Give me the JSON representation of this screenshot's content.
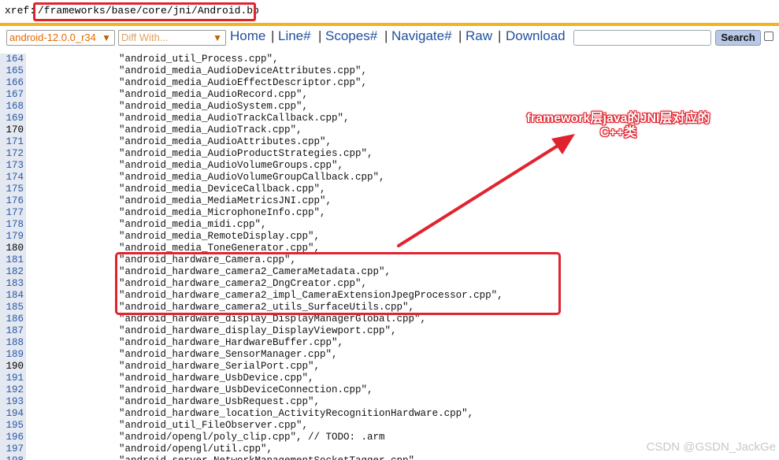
{
  "xref": {
    "label": "xref:",
    "path": "/frameworks/base/core/jni/Android.bp"
  },
  "toolbar": {
    "revision_select": "android-12.0.0_r34",
    "diff_select": "Diff With...",
    "links": [
      "Home",
      "Line#",
      "Scopes#",
      "Navigate#",
      "Raw",
      "Download"
    ],
    "separator": "|",
    "search_value": "",
    "search_button": "Search"
  },
  "code_lines": [
    {
      "n": "164",
      "text": "\"android_util_Process.cpp\","
    },
    {
      "n": "165",
      "text": "\"android_media_AudioDeviceAttributes.cpp\","
    },
    {
      "n": "166",
      "text": "\"android_media_AudioEffectDescriptor.cpp\","
    },
    {
      "n": "167",
      "text": "\"android_media_AudioRecord.cpp\","
    },
    {
      "n": "168",
      "text": "\"android_media_AudioSystem.cpp\","
    },
    {
      "n": "169",
      "text": "\"android_media_AudioTrackCallback.cpp\","
    },
    {
      "n": "170",
      "text": "\"android_media_AudioTrack.cpp\","
    },
    {
      "n": "171",
      "text": "\"android_media_AudioAttributes.cpp\","
    },
    {
      "n": "172",
      "text": "\"android_media_AudioProductStrategies.cpp\","
    },
    {
      "n": "173",
      "text": "\"android_media_AudioVolumeGroups.cpp\","
    },
    {
      "n": "174",
      "text": "\"android_media_AudioVolumeGroupCallback.cpp\","
    },
    {
      "n": "175",
      "text": "\"android_media_DeviceCallback.cpp\","
    },
    {
      "n": "176",
      "text": "\"android_media_MediaMetricsJNI.cpp\","
    },
    {
      "n": "177",
      "text": "\"android_media_MicrophoneInfo.cpp\","
    },
    {
      "n": "178",
      "text": "\"android_media_midi.cpp\","
    },
    {
      "n": "179",
      "text": "\"android_media_RemoteDisplay.cpp\","
    },
    {
      "n": "180",
      "text": "\"android_media_ToneGenerator.cpp\","
    },
    {
      "n": "181",
      "text": "\"android_hardware_Camera.cpp\","
    },
    {
      "n": "182",
      "text": "\"android_hardware_camera2_CameraMetadata.cpp\","
    },
    {
      "n": "183",
      "text": "\"android_hardware_camera2_DngCreator.cpp\","
    },
    {
      "n": "184",
      "text": "\"android_hardware_camera2_impl_CameraExtensionJpegProcessor.cpp\","
    },
    {
      "n": "185",
      "text": "\"android_hardware_camera2_utils_SurfaceUtils.cpp\","
    },
    {
      "n": "186",
      "text": "\"android_hardware_display_DisplayManagerGlobal.cpp\","
    },
    {
      "n": "187",
      "text": "\"android_hardware_display_DisplayViewport.cpp\","
    },
    {
      "n": "188",
      "text": "\"android_hardware_HardwareBuffer.cpp\","
    },
    {
      "n": "189",
      "text": "\"android_hardware_SensorManager.cpp\","
    },
    {
      "n": "190",
      "text": "\"android_hardware_SerialPort.cpp\","
    },
    {
      "n": "191",
      "text": "\"android_hardware_UsbDevice.cpp\","
    },
    {
      "n": "192",
      "text": "\"android_hardware_UsbDeviceConnection.cpp\","
    },
    {
      "n": "193",
      "text": "\"android_hardware_UsbRequest.cpp\","
    },
    {
      "n": "194",
      "text": "\"android_hardware_location_ActivityRecognitionHardware.cpp\","
    },
    {
      "n": "195",
      "text": "\"android_util_FileObserver.cpp\","
    },
    {
      "n": "196",
      "text": "\"android/opengl/poly_clip.cpp\", // TODO: .arm"
    },
    {
      "n": "197",
      "text": "\"android/opengl/util.cpp\","
    },
    {
      "n": "198",
      "text": "\"android_server_NetworkManagementSocketTagger.cpp\","
    }
  ],
  "bold_line_numbers": [
    "170",
    "180",
    "190"
  ],
  "annotation": {
    "line1": "framework层java的JNI层对应的",
    "line2": "C++类",
    "color": "#e0242f"
  },
  "watermark": "CSDN @GSDN_JackGe",
  "colors": {
    "accent_rule": "#f0b41e",
    "link": "#2050a0",
    "line_number": "#2a58a8",
    "gutter": "#e4e8f0",
    "highlight": "#e0242f"
  }
}
